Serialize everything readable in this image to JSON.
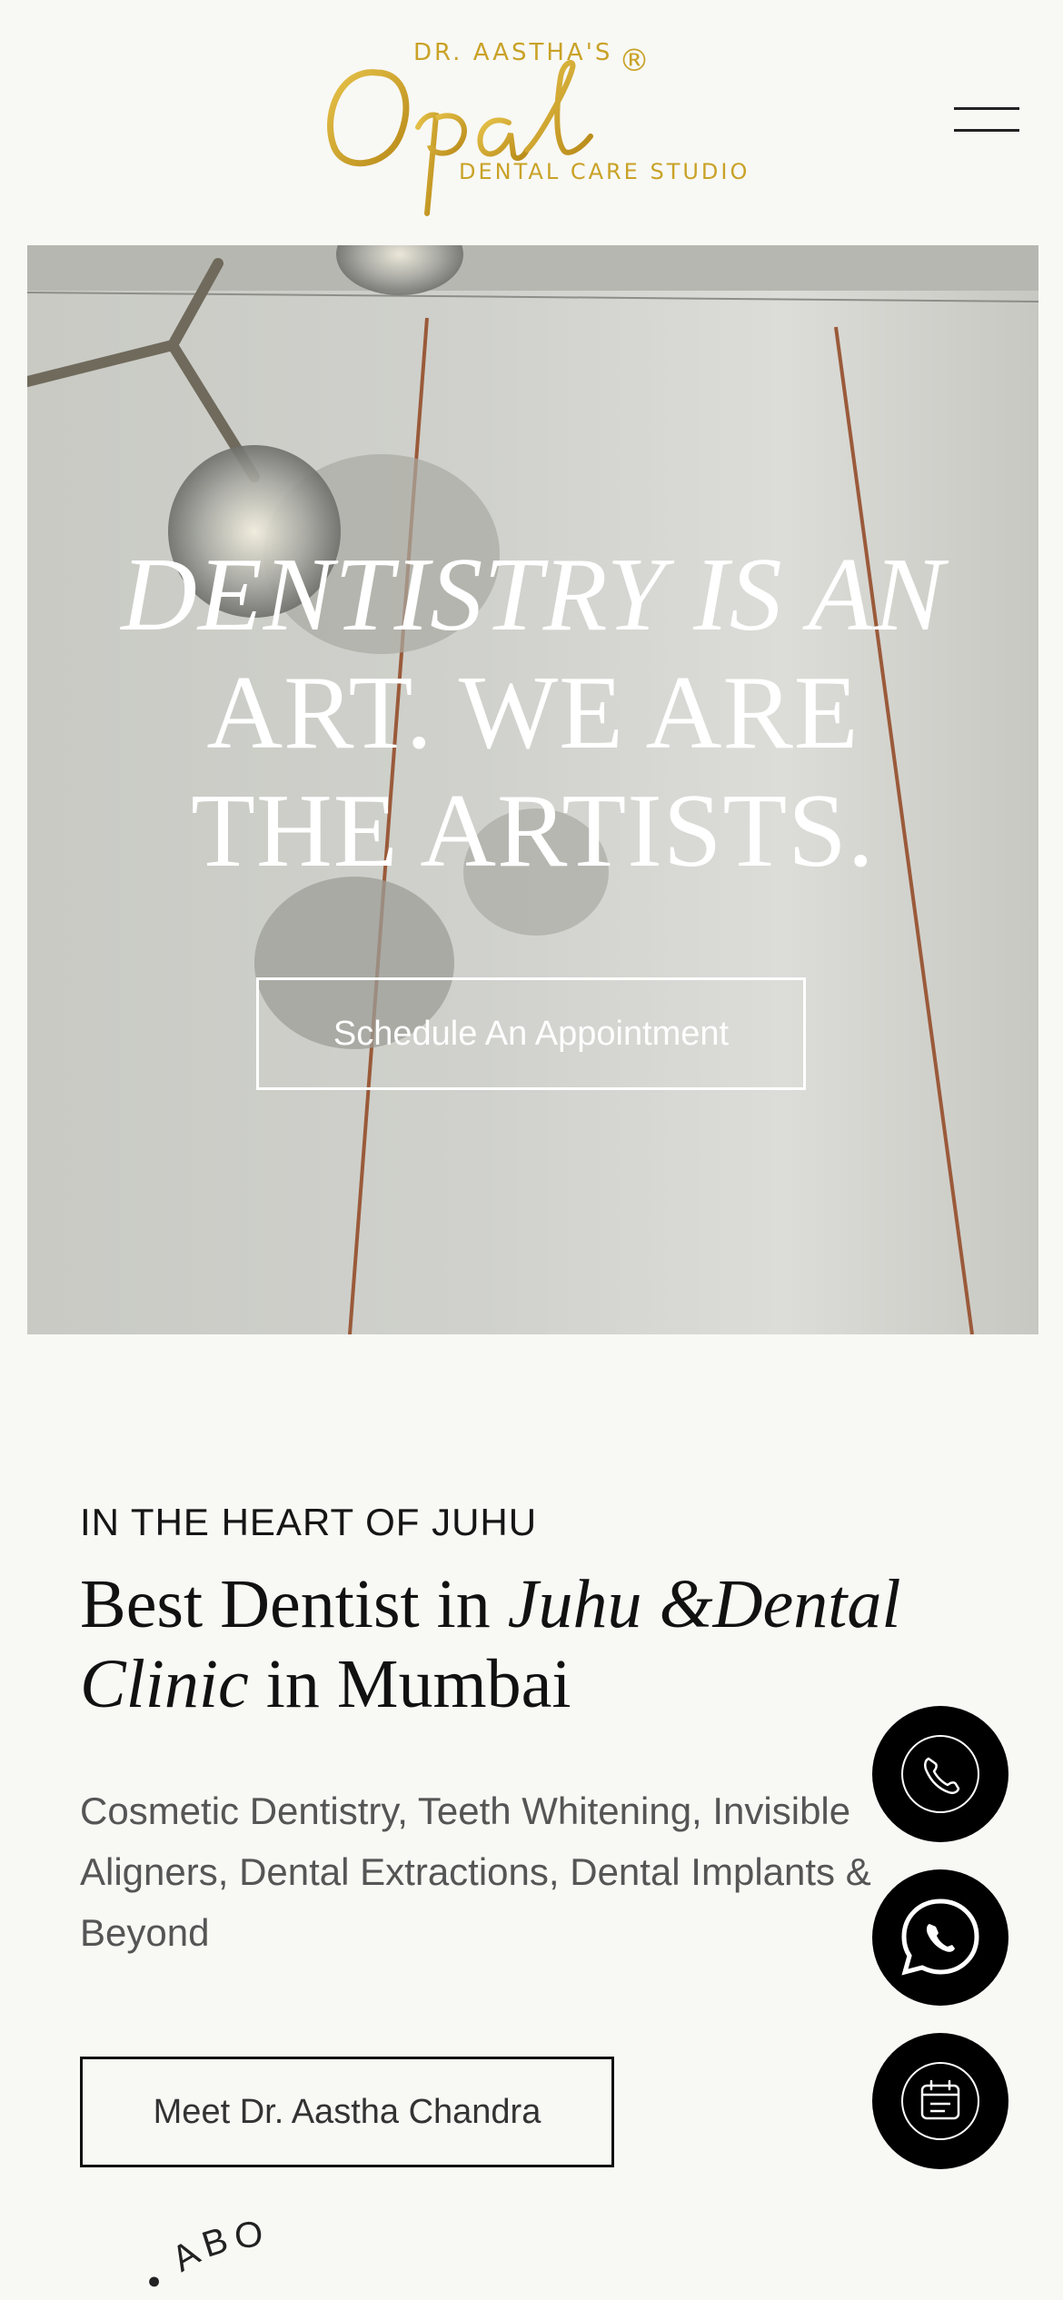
{
  "header": {
    "logo": {
      "prefix": "DR. AASTHA'S",
      "wordmark": "Opal",
      "registered": "®",
      "subtitle": "DENTAL CARE STUDIO"
    },
    "menu_icon": "hamburger-menu-icon"
  },
  "hero": {
    "headline_line1": "DENTISTRY IS AN",
    "headline_line2": "ART. WE ARE",
    "headline_line3": "THE ARTISTS.",
    "cta_label": "Schedule An Appointment"
  },
  "intro": {
    "eyebrow": "IN THE HEART OF JUHU",
    "title_part1": "Best Dentist in ",
    "title_italic1": "Juhu &Dental",
    "title_italic2": "Clinic",
    "title_part2": " in Mumbai",
    "description": "Cosmetic Dentistry, Teeth Whitening, Invisible Aligners, Dental Extractions, Dental Implants & Beyond",
    "button_label": "Meet Dr. Aastha Chandra"
  },
  "floating_actions": [
    {
      "icon": "phone-icon"
    },
    {
      "icon": "whatsapp-icon"
    },
    {
      "icon": "calendar-icon"
    }
  ],
  "circular_badge": {
    "text": "ME • ABO"
  },
  "colors": {
    "brand_gold": "#c9a227",
    "background": "#f8f8f5",
    "fab_background": "#000000"
  }
}
